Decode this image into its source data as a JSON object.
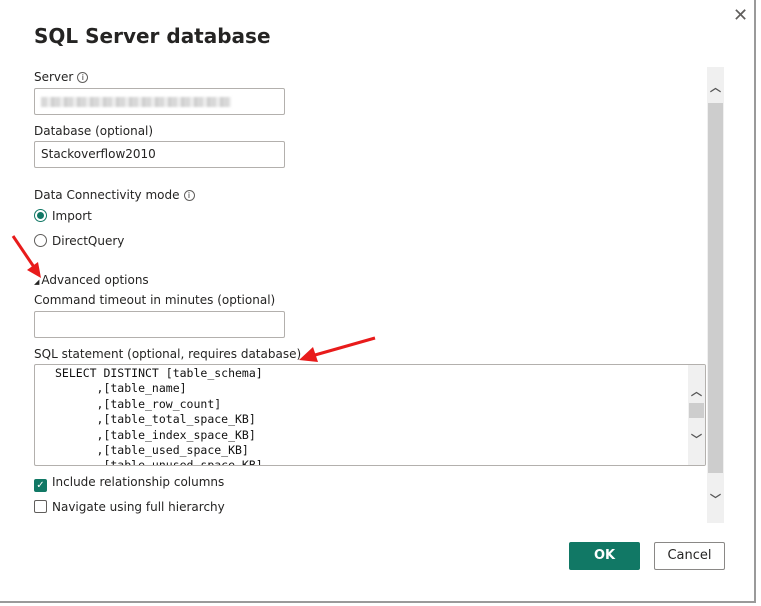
{
  "dialog": {
    "title": "SQL Server database",
    "close_icon": "close-icon"
  },
  "server": {
    "label": "Server",
    "value": "(blurred)"
  },
  "database": {
    "label": "Database (optional)",
    "value": "Stackoverflow2010"
  },
  "connectivity": {
    "label": "Data Connectivity mode",
    "options": [
      {
        "label": "Import",
        "selected": true
      },
      {
        "label": "DirectQuery",
        "selected": false
      }
    ]
  },
  "advanced": {
    "label": "Advanced options"
  },
  "timeout": {
    "label": "Command timeout in minutes (optional)",
    "value": ""
  },
  "sql": {
    "label": "SQL statement (optional, requires database)",
    "value": "SELECT DISTINCT [table_schema]\n      ,[table_name]\n      ,[table_row_count]\n      ,[table_total_space_KB]\n      ,[table_index_space_KB]\n      ,[table_used_space_KB]\n      ,[table_unused_space_KB]"
  },
  "checkboxes": [
    {
      "label": "Include relationship columns",
      "checked": true
    },
    {
      "label": "Navigate using full hierarchy",
      "checked": false
    }
  ],
  "buttons": {
    "ok": "OK",
    "cancel": "Cancel"
  },
  "colors": {
    "accent": "#117865",
    "annotation_arrow": "#e81b1b"
  }
}
